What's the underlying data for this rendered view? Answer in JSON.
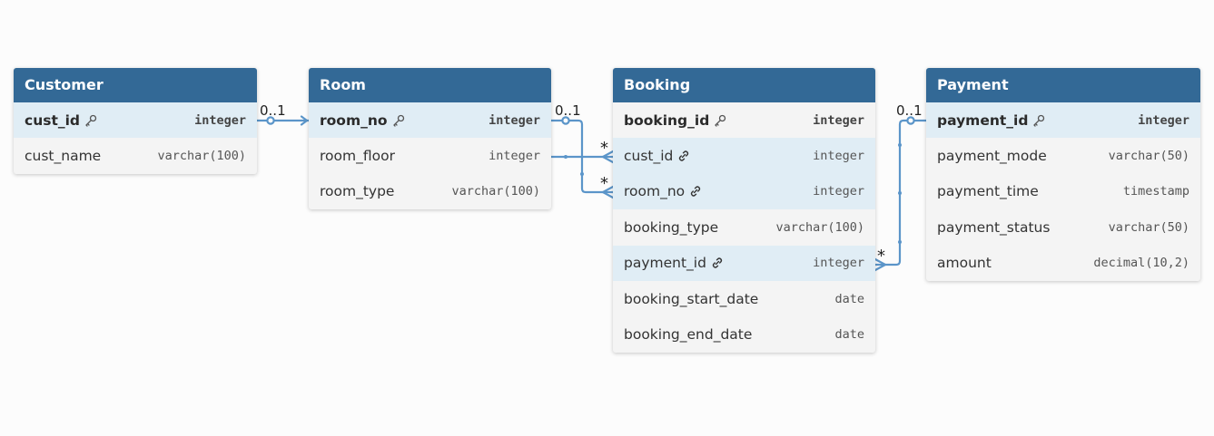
{
  "colors": {
    "header": "#336996",
    "connector": "#5b95c9",
    "highlight": "#e0edf5"
  },
  "tables": [
    {
      "name": "Customer",
      "fields": [
        {
          "name": "cust_id",
          "type": "integer",
          "pk": true,
          "icon": "key-icon"
        },
        {
          "name": "cust_name",
          "type": "varchar(100)"
        }
      ]
    },
    {
      "name": "Room",
      "fields": [
        {
          "name": "room_no",
          "type": "integer",
          "pk": true,
          "icon": "key-icon"
        },
        {
          "name": "room_floor",
          "type": "integer"
        },
        {
          "name": "room_type",
          "type": "varchar(100)"
        }
      ]
    },
    {
      "name": "Booking",
      "fields": [
        {
          "name": "booking_id",
          "type": "integer",
          "pk": true,
          "icon": "key-icon"
        },
        {
          "name": "cust_id",
          "type": "integer",
          "fk": true,
          "icon": "link-icon"
        },
        {
          "name": "room_no",
          "type": "integer",
          "fk": true,
          "icon": "link-icon"
        },
        {
          "name": "booking_type",
          "type": "varchar(100)"
        },
        {
          "name": "payment_id",
          "type": "integer",
          "fk": true,
          "icon": "link-icon"
        },
        {
          "name": "booking_start_date",
          "type": "date"
        },
        {
          "name": "booking_end_date",
          "type": "date"
        }
      ]
    },
    {
      "name": "Payment",
      "fields": [
        {
          "name": "payment_id",
          "type": "integer",
          "pk": true,
          "icon": "key-icon"
        },
        {
          "name": "payment_mode",
          "type": "varchar(50)"
        },
        {
          "name": "payment_time",
          "type": "timestamp"
        },
        {
          "name": "payment_status",
          "type": "varchar(50)"
        },
        {
          "name": "amount",
          "type": "decimal(10,2)"
        }
      ]
    }
  ],
  "relationships": [
    {
      "from_table": "Customer",
      "from_field": "cust_id",
      "from_card": "0..1",
      "to_table": "Booking",
      "to_field": "cust_id",
      "to_card": "*"
    },
    {
      "from_table": "Room",
      "from_field": "room_no",
      "from_card": "0..1",
      "to_table": "Booking",
      "to_field": "room_no",
      "to_card": "*"
    },
    {
      "from_table": "Payment",
      "from_field": "payment_id",
      "from_card": "0..1",
      "to_table": "Booking",
      "to_field": "payment_id",
      "to_card": "*"
    }
  ]
}
